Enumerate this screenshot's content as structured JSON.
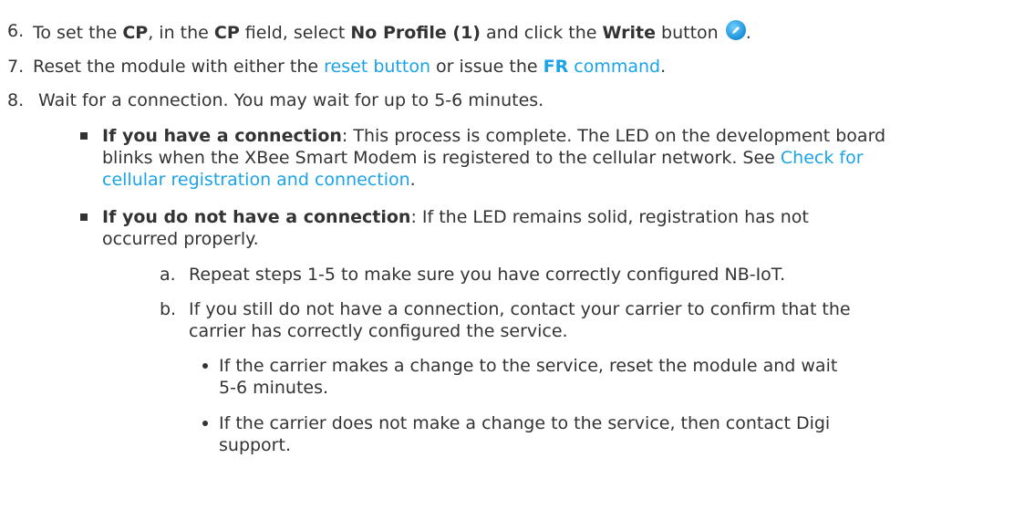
{
  "steps": [
    {
      "number": "6.",
      "parts": [
        "To set the ",
        "CP",
        ", in the ",
        "CP",
        " field, select ",
        "No Profile (1)",
        " and click the ",
        "Write",
        " button ",
        "."
      ]
    },
    {
      "number": "7.",
      "parts": [
        "Reset the module with either the ",
        "reset button",
        " or issue the ",
        "FR",
        " command",
        "."
      ]
    },
    {
      "number": "8.",
      "text": "Wait for a connection. You may wait for up to 5-6 minutes."
    }
  ],
  "bullets": [
    {
      "bold": "If you have a connection",
      "line1": ": This process is complete. The LED on the development board",
      "line2": "blinks when the XBee Smart Modem is registered to the cellular network. See ",
      "link_a": "Check for",
      "link_b": "cellular registration and connection",
      "end": "."
    },
    {
      "bold": "If you do not have a connection",
      "line1": ": If the LED remains solid, registration has not",
      "line2": "occurred properly."
    }
  ],
  "sub_steps": [
    {
      "letter": "a.",
      "line1": "Repeat steps 1-5 to make sure you have correctly configured NB-IoT."
    },
    {
      "letter": "b.",
      "line1": "If you still do not have a connection, contact your carrier to confirm that the",
      "line2": "carrier has correctly configured the service."
    }
  ],
  "sub_bullets": [
    {
      "line1": "If the carrier makes a change to the service, reset the module and wait",
      "line2": "5-6 minutes."
    },
    {
      "line1": "If the carrier does not make a change to the service, then contact Digi",
      "line2": "support."
    }
  ],
  "icons": {
    "write": "write-pencil-icon"
  },
  "colors": {
    "link": "#1aa3e8",
    "text": "#333333"
  }
}
